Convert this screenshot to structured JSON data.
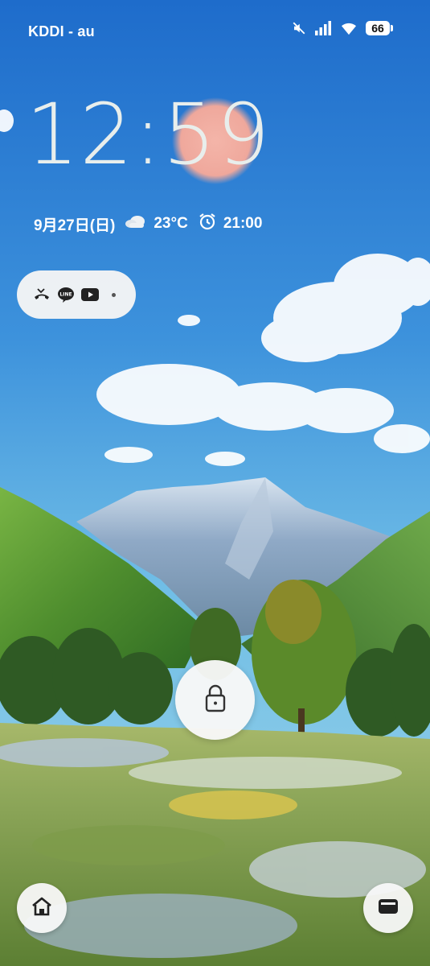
{
  "status_bar": {
    "carrier": "KDDI - au",
    "icons": [
      "mute-icon",
      "signal-icon",
      "wifi-icon"
    ],
    "battery_level": "66"
  },
  "lock_screen": {
    "time": "12:59",
    "date": "9月27日(日)",
    "weather_icon": "cloud-icon",
    "temperature": "23°C",
    "alarm_icon": "alarm-clock-icon",
    "alarm_time": "21:00"
  },
  "notifications": {
    "icons": [
      "missed-call-icon",
      "line-app-icon",
      "youtube-icon",
      "more-dot"
    ]
  },
  "controls": {
    "unlock_icon": "lock-icon",
    "left_shortcut_icon": "home-icon",
    "right_shortcut_icon": "wallet-icon"
  },
  "colors": {
    "sky_top": "#1f6fcb",
    "sky_bottom": "#79c2e6",
    "pill_bg": "#f5f5f5",
    "clock_text": "#e8eeec",
    "sun": "#f2b0a6"
  }
}
